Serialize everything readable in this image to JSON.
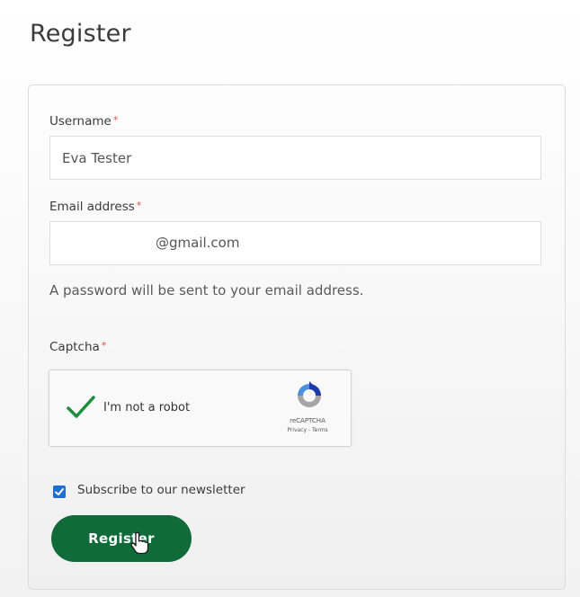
{
  "page": {
    "title": "Register"
  },
  "form": {
    "username": {
      "label": "Username",
      "required_mark": "*",
      "value": "Eva Tester"
    },
    "email": {
      "label": "Email address",
      "required_mark": "*",
      "value": "@gmail.com"
    },
    "password_hint": "A password will be sent to your email address.",
    "captcha": {
      "label": "Captcha",
      "required_mark": "*",
      "checkbox_label": "I'm not a robot",
      "brand": "reCAPTCHA",
      "links": "Privacy - Terms",
      "checked": true,
      "check_color": "#1e8e3e"
    },
    "newsletter": {
      "label": "Subscribe to our newsletter",
      "checked": true,
      "checkbox_color": "#1f6fd1"
    },
    "submit": {
      "label": "Register",
      "color": "#0f6b3a"
    }
  },
  "icons": {
    "captcha_check": "check-mark-icon",
    "recaptcha_logo": "recaptcha-logo-icon",
    "cursor": "hand-pointer-cursor-icon"
  }
}
